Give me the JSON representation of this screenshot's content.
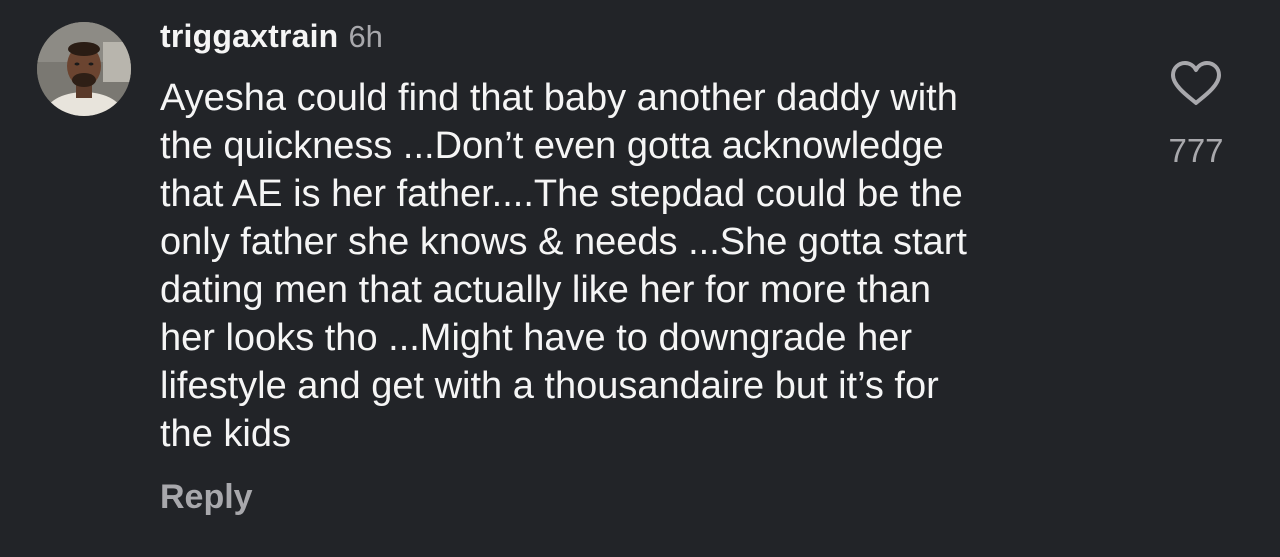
{
  "comment": {
    "username": "triggaxtrain",
    "time": "6h",
    "text": "Ayesha could find that baby another daddy with\nthe quickness ...Don’t even gotta acknowledge\nthat AE is her father....The stepdad could be the\nonly father she knows & needs ...She gotta start\ndating men that actually like her for more than\nher looks tho ...Might have to downgrade her\nlifestyle and get with a thousandaire but it’s for\nthe kids",
    "reply_label": "Reply",
    "like_count": "777",
    "like_icon": "heart-outline-icon"
  },
  "colors": {
    "background": "#222428",
    "primary_text": "#f5f5f5",
    "secondary_text": "#a8a8ac"
  }
}
